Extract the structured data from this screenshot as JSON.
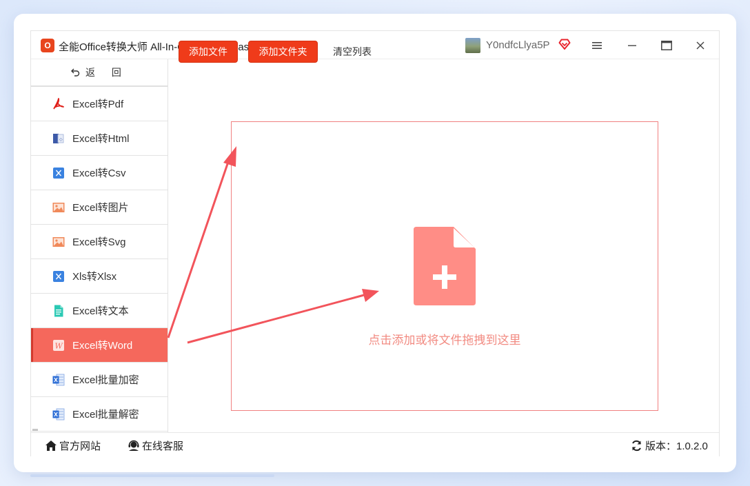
{
  "window": {
    "title": "全能Office转换大师 All-In-One Office Master",
    "logo_text": "O",
    "username": "Y0ndfcLlya5P",
    "controls": [
      "menu",
      "minimize",
      "maximize",
      "close"
    ]
  },
  "sidebar": {
    "back_label": "返 回",
    "items": [
      {
        "label": "Excel转Pdf",
        "icon": "pdf-icon",
        "active": false
      },
      {
        "label": "Excel转Html",
        "icon": "html-icon",
        "active": false
      },
      {
        "label": "Excel转Csv",
        "icon": "excel-x-icon",
        "active": false
      },
      {
        "label": "Excel转图片",
        "icon": "image-icon",
        "active": false
      },
      {
        "label": "Excel转Svg",
        "icon": "image-icon",
        "active": false
      },
      {
        "label": "Xls转Xlsx",
        "icon": "excel-x-icon",
        "active": false
      },
      {
        "label": "Excel转文本",
        "icon": "text-file-icon",
        "active": false
      },
      {
        "label": "Excel转Word",
        "icon": "word-icon",
        "active": true
      },
      {
        "label": "Excel批量加密",
        "icon": "excel-sheet-icon",
        "active": false
      },
      {
        "label": "Excel批量解密",
        "icon": "excel-sheet-icon",
        "active": false
      }
    ]
  },
  "toolbar": {
    "add_file": "添加文件",
    "add_folder": "添加文件夹",
    "clear_list": "清空列表"
  },
  "dropzone": {
    "hint": "点击添加或将文件拖拽到这里"
  },
  "footer": {
    "website": "官方网站",
    "support": "在线客服",
    "version": "版本：1.0.2.0"
  },
  "colors": {
    "accent": "#ef3b1a",
    "active_item": "#f5685c",
    "dropzone_border": "#f08080",
    "hint_text": "#f28b82",
    "arrow": "#f2545b"
  }
}
